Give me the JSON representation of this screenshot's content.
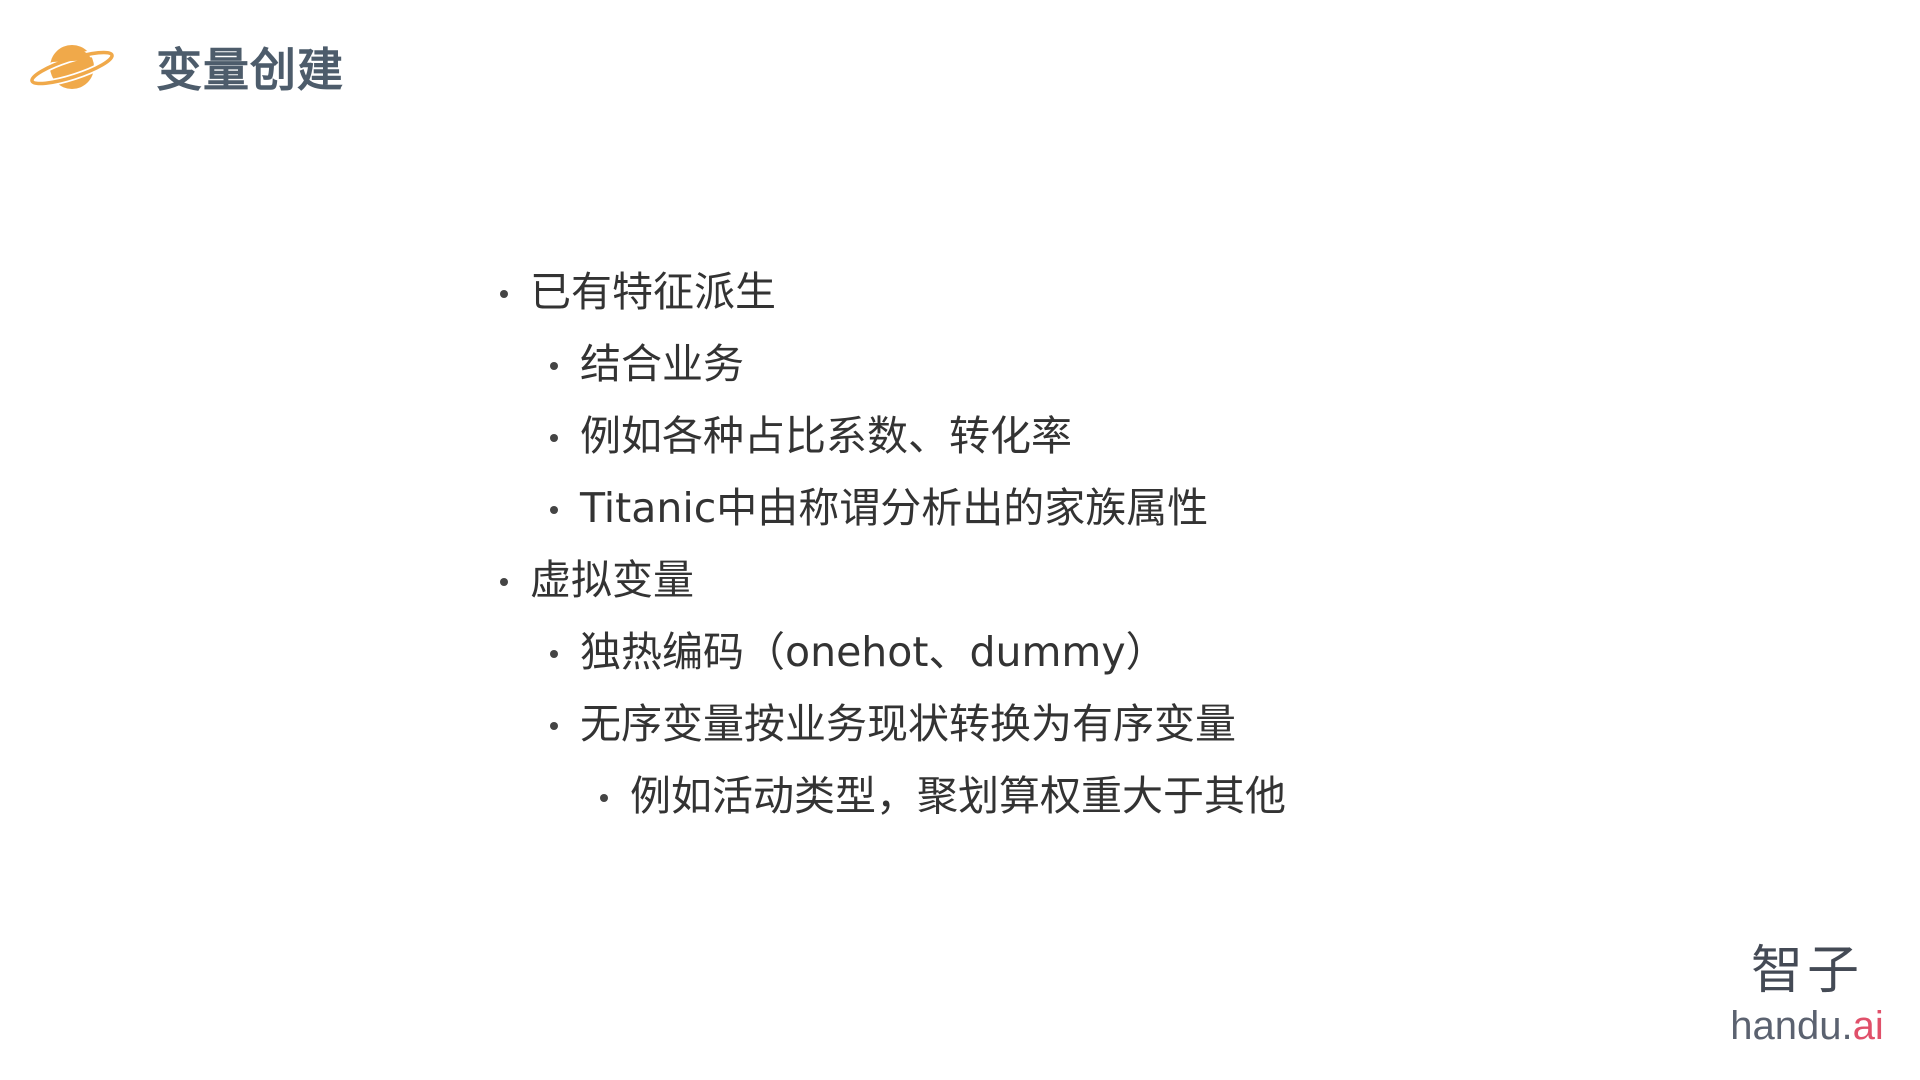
{
  "header": {
    "icon": "planet-icon",
    "title": "变量创建",
    "icon_color": "#f0a94a"
  },
  "bullets": [
    {
      "level": 1,
      "text": "已有特征派生"
    },
    {
      "level": 2,
      "text": "结合业务"
    },
    {
      "level": 2,
      "text": "例如各种占比系数、转化率"
    },
    {
      "level": 2,
      "text": "Titanic中由称谓分析出的家族属性"
    },
    {
      "level": 1,
      "text": "虚拟变量"
    },
    {
      "level": 2,
      "text": "独热编码（onehot、dummy）"
    },
    {
      "level": 2,
      "text": "无序变量按业务现状转换为有序变量"
    },
    {
      "level": 3,
      "text": "例如活动类型，聚划算权重大于其他"
    }
  ],
  "brand": {
    "cn": "智子",
    "en_prefix": "handu.",
    "en_suffix": "ai",
    "accent_color": "#e0506a"
  }
}
